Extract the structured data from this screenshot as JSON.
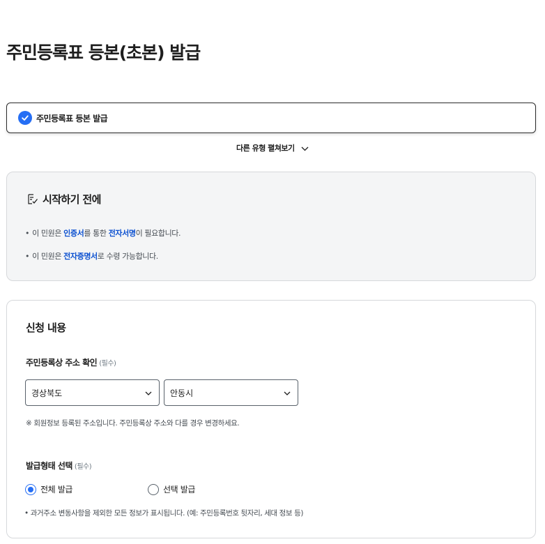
{
  "page": {
    "title": "주민등록표 등본(초본) 발급"
  },
  "selected_type": {
    "label": "주민등록표 등본 발급",
    "icon": "check-circle-icon",
    "accent": "#256ef4"
  },
  "expand": {
    "label": "다른 유형 펼쳐보기"
  },
  "notice": {
    "title": "시작하기 전에",
    "items": [
      {
        "bullet": "•",
        "pre": "이 민원은 ",
        "hl1": "인증서",
        "mid": "를 통한 ",
        "hl2": "전자서명",
        "post": "이 필요합니다."
      },
      {
        "bullet": "•",
        "pre": "이 민원은 ",
        "hl1": "전자증명서",
        "post": "로 수령 가능합니다."
      }
    ]
  },
  "form": {
    "section_title": "신청 내용",
    "address": {
      "label": "주민등록상 주소 확인",
      "required": "(필수)",
      "province": "경상북도",
      "city": "안동시",
      "hint": "※ 회원정보 등록된 주소입니다. 주민등록상 주소와 다를 경우 변경하세요."
    },
    "issue_type": {
      "label": "발급형태 선택",
      "required": "(필수)",
      "options": [
        {
          "label": "전체 발급",
          "selected": true
        },
        {
          "label": "선택 발급",
          "selected": false
        }
      ],
      "note": "• 과거주소 변동사항을 제외한 모든 정보가 표시됩니다. (예: 주민등록번호 뒷자리, 세대 정보 등)"
    }
  }
}
